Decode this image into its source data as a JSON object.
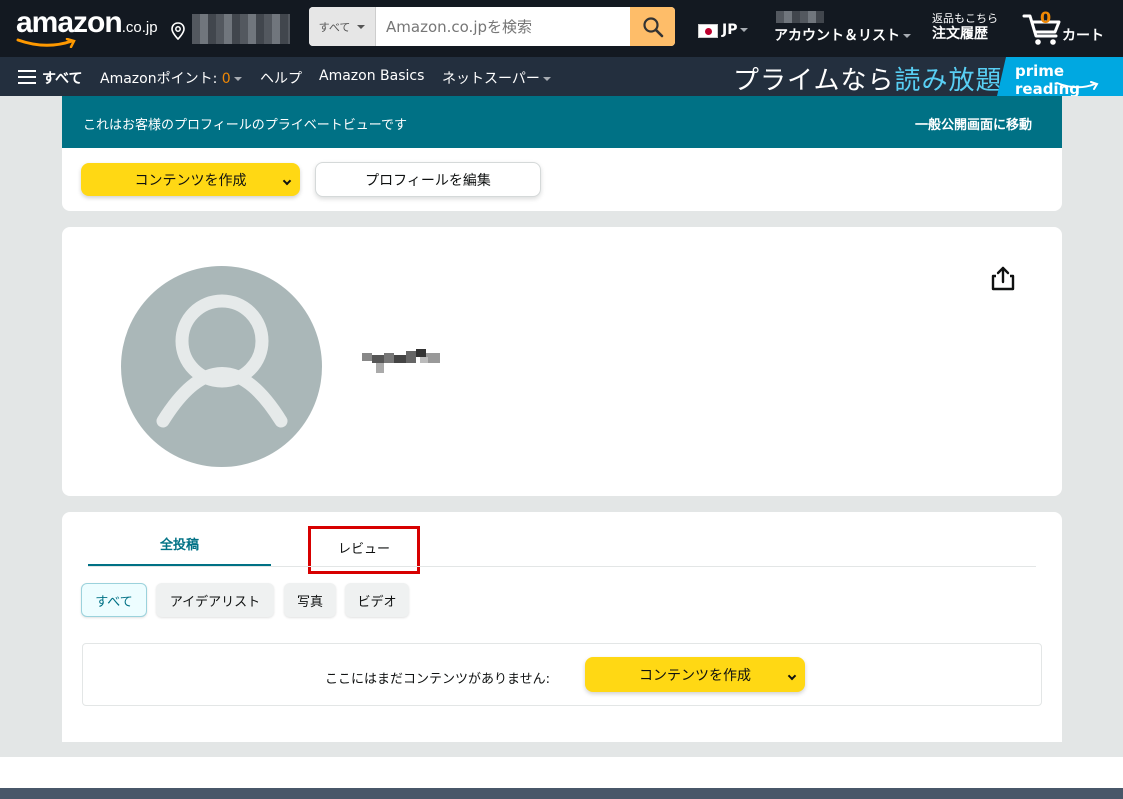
{
  "header": {
    "logo_text": "amazon",
    "logo_tld": ".co.jp",
    "search": {
      "category": "すべて",
      "placeholder": "Amazon.co.jpを検索"
    },
    "language": "JP",
    "account_label": "アカウント＆リスト",
    "orders_line1": "返品もこちら",
    "orders_line2": "注文履歴",
    "cart_count": "0",
    "cart_label": "カート"
  },
  "subnav": {
    "all_label": "すべて",
    "points_label": "Amazonポイント:",
    "points_value": "0",
    "help": "ヘルプ",
    "basics": "Amazon Basics",
    "net_super": "ネットスーパー",
    "promo_text_a": "プライムなら",
    "promo_text_b": "読み放題",
    "prime_badge": "prime reading"
  },
  "private_view": {
    "message": "これはお客様のプロフィールのプライベートビューです",
    "public_link": "一般公開画面に移動"
  },
  "actions": {
    "create_content": "コンテンツを作成",
    "edit_profile": "プロフィールを編集"
  },
  "tabs": {
    "all_posts": "全投稿",
    "reviews": "レビュー"
  },
  "filters": [
    "すべて",
    "アイデアリスト",
    "写真",
    "ビデオ"
  ],
  "empty_state": {
    "message": "ここにはまだコンテンツがありません:",
    "create_button": "コンテンツを作成"
  },
  "colors": {
    "nav_bg": "#131921",
    "subnav_bg": "#232f3e",
    "teal": "#007185",
    "yellow_button": "#ffd814",
    "search_button": "#febd69",
    "highlight_border": "#d70000"
  }
}
